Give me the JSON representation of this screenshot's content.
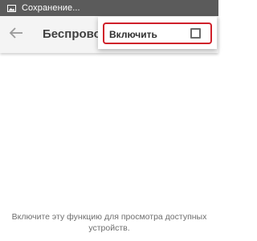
{
  "status_bar": {
    "icon": "image-icon",
    "text": "Сохранение...",
    "background": "#5b5b5b"
  },
  "app_bar": {
    "back_icon": "arrow-left-icon",
    "title": "Беспроводной дисплей",
    "background": "#f4f4f4"
  },
  "overflow_menu": {
    "item": {
      "label": "Включить",
      "checked": false
    },
    "highlight_color": "#d0202a"
  },
  "content": {
    "empty_hint_line1": "Включите эту функцию для просмотра доступных",
    "empty_hint_line2": "устройств."
  }
}
